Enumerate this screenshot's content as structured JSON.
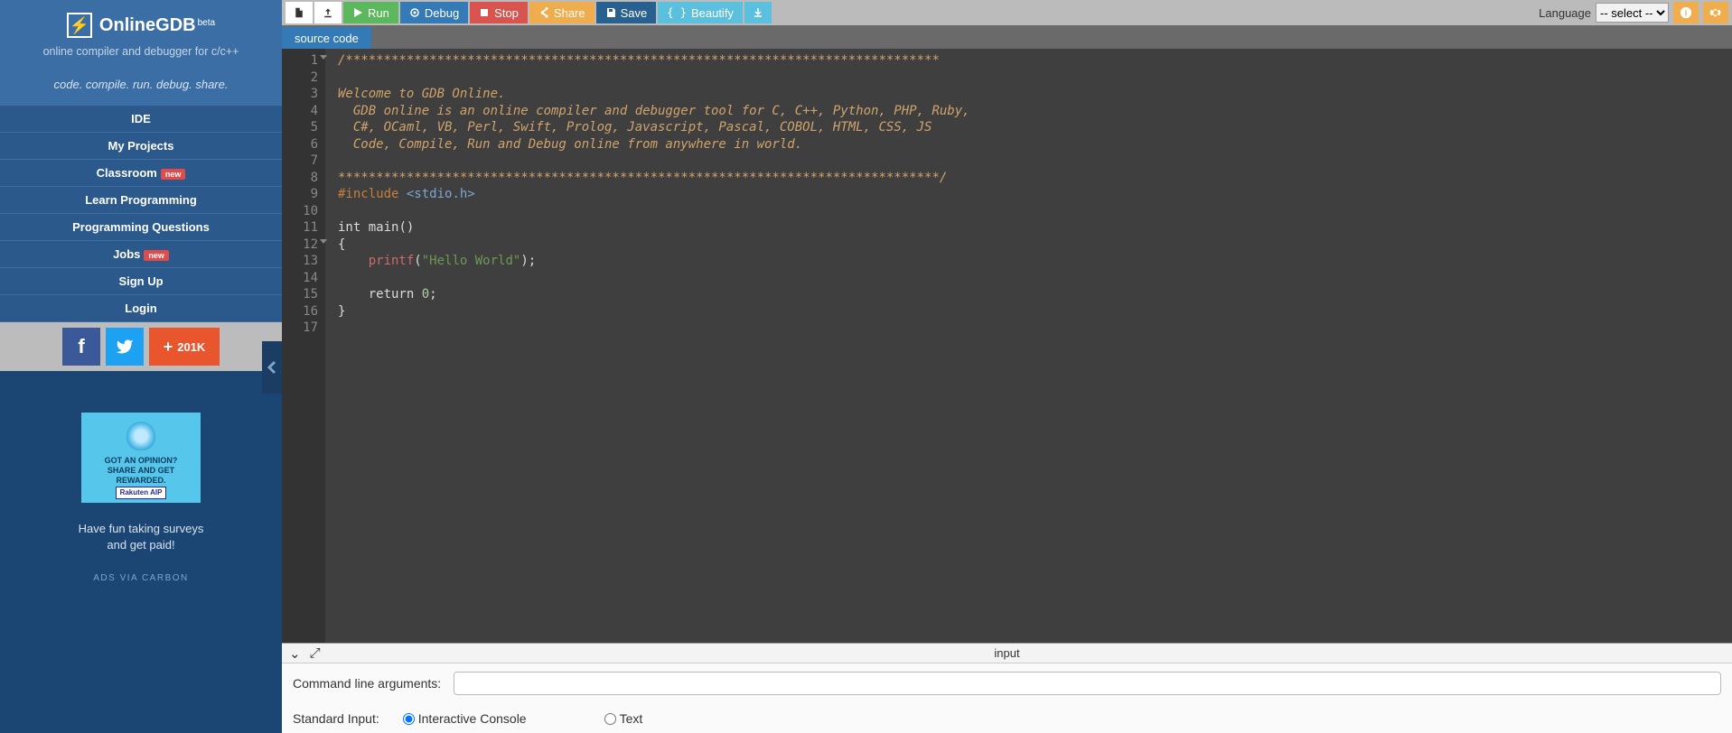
{
  "brand": {
    "name": "OnlineGDB",
    "beta": "beta"
  },
  "subtitle": "online compiler and debugger for c/c++",
  "tagline": "code. compile. run. debug. share.",
  "sidebar": {
    "items": [
      {
        "label": "IDE",
        "badge": null
      },
      {
        "label": "My Projects",
        "badge": null
      },
      {
        "label": "Classroom",
        "badge": "new"
      },
      {
        "label": "Learn Programming",
        "badge": null
      },
      {
        "label": "Programming Questions",
        "badge": null
      },
      {
        "label": "Jobs",
        "badge": "new"
      },
      {
        "label": "Sign Up",
        "badge": null
      },
      {
        "label": "Login",
        "badge": null
      }
    ]
  },
  "social": {
    "share_count": "201K"
  },
  "ad": {
    "line1": "GOT AN OPINION?",
    "line2": "SHARE AND GET REWARDED.",
    "brand": "Rakuten AIP",
    "surveys_line1": "Have fun taking surveys",
    "surveys_line2": "and get paid!",
    "carbon": "ADS VIA CARBON"
  },
  "toolbar": {
    "run": "Run",
    "debug": "Debug",
    "stop": "Stop",
    "share": "Share",
    "save": "Save",
    "beautify": "Beautify",
    "language_label": "Language",
    "language_value": "-- select --"
  },
  "tabs": {
    "active": "source code"
  },
  "code": {
    "lines": [
      "/******************************************************************************",
      "",
      "Welcome to GDB Online.",
      "  GDB online is an online compiler and debugger tool for C, C++, Python, PHP, Ruby, ",
      "  C#, OCaml, VB, Perl, Swift, Prolog, Javascript, Pascal, COBOL, HTML, CSS, JS",
      "  Code, Compile, Run and Debug online from anywhere in world.",
      "",
      "*******************************************************************************/",
      "#include <stdio.h>",
      "",
      "int main()",
      "{",
      "    printf(\"Hello World\");",
      "",
      "    return 0;",
      "}",
      ""
    ]
  },
  "bottom": {
    "title": "input",
    "cmd_label": "Command line arguments:",
    "stdin_label": "Standard Input:",
    "opt_interactive": "Interactive Console",
    "opt_text": "Text"
  }
}
